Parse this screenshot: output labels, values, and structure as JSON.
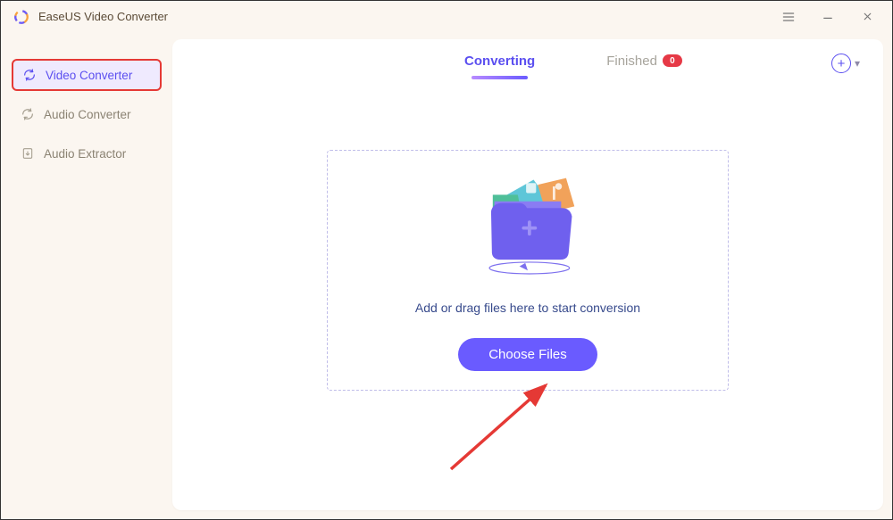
{
  "app": {
    "title": "EaseUS Video Converter"
  },
  "sidebar": {
    "items": [
      {
        "label": "Video Converter"
      },
      {
        "label": "Audio Converter"
      },
      {
        "label": "Audio Extractor"
      }
    ]
  },
  "tabs": {
    "converting": "Converting",
    "finished": "Finished",
    "finished_badge": "0"
  },
  "dropzone": {
    "hint": "Add or drag files here to start conversion",
    "button": "Choose Files"
  }
}
